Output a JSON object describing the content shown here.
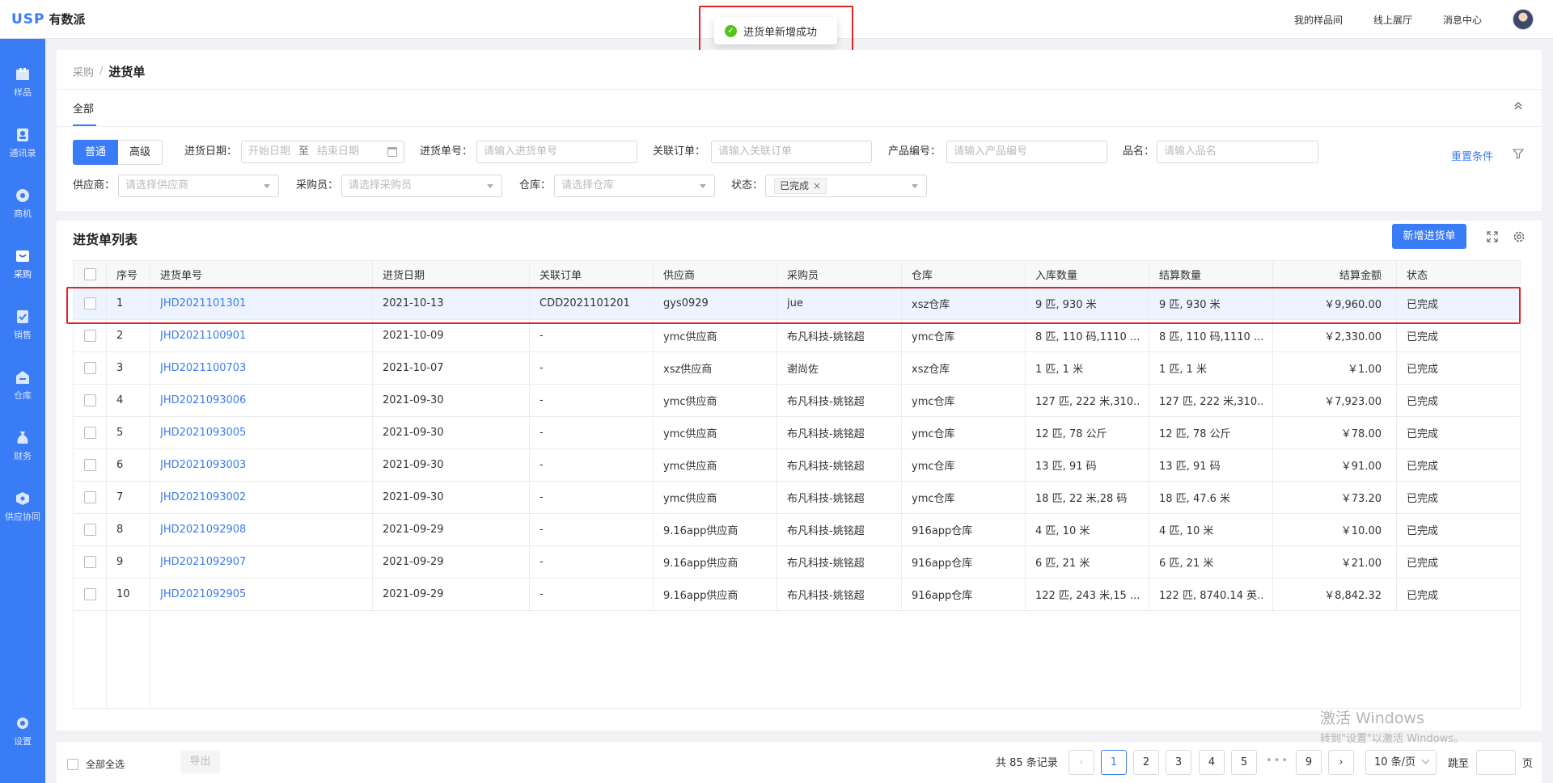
{
  "app": {
    "logo_mark": "USP",
    "logo_name": "有数派"
  },
  "topnav": {
    "items": [
      "我的样品间",
      "线上展厅",
      "消息中心"
    ]
  },
  "toast": {
    "message": "进货单新增成功"
  },
  "sidebar": {
    "items": [
      {
        "label": "样品",
        "icon": "sample-icon"
      },
      {
        "label": "通讯录",
        "icon": "contacts-icon"
      },
      {
        "label": "商机",
        "icon": "opportunity-icon"
      },
      {
        "label": "采购",
        "icon": "purchase-icon",
        "active": true
      },
      {
        "label": "销售",
        "icon": "sales-icon"
      },
      {
        "label": "仓库",
        "icon": "warehouse-icon"
      },
      {
        "label": "财务",
        "icon": "finance-icon"
      },
      {
        "label": "供应协同",
        "icon": "supply-icon"
      }
    ],
    "settings": "设置"
  },
  "breadcrumb": {
    "parent": "采购",
    "sep": "/",
    "current": "进货单"
  },
  "tabs": {
    "all": "全部"
  },
  "search": {
    "mode_normal": "普通",
    "mode_advanced": "高级",
    "date_label": "进货日期：",
    "date_start": "开始日期",
    "date_sep": "至",
    "date_end": "结束日期",
    "order_no_label": "进货单号：",
    "order_no_placeholder": "请输入进货单号",
    "related_label": "关联订单：",
    "related_placeholder": "请输入关联订单",
    "product_no_label": "产品编号：",
    "product_no_placeholder": "请输入产品编号",
    "product_name_label": "品名：",
    "product_name_placeholder": "请输入品名",
    "supplier_label": "供应商：",
    "supplier_placeholder": "请选择供应商",
    "buyer_label": "采购员：",
    "buyer_placeholder": "请选择采购员",
    "warehouse_label": "仓库：",
    "warehouse_placeholder": "请选择仓库",
    "status_label": "状态：",
    "status_tag": "已完成",
    "status_tag_close": "×",
    "reset": "重置条件"
  },
  "list": {
    "title": "进货单列表",
    "add_button": "新增进货单"
  },
  "table": {
    "headers": [
      "序号",
      "进货单号",
      "进货日期",
      "关联订单",
      "供应商",
      "采购员",
      "仓库",
      "入库数量",
      "结算数量",
      "结算金额",
      "状态"
    ],
    "rows": [
      [
        "1",
        "JHD2021101301",
        "2021-10-13",
        "CDD2021101201",
        "gys0929",
        "jue",
        "xsz仓库",
        "9 匹, 930 米",
        "9 匹, 930 米",
        "￥9,960.00",
        "已完成"
      ],
      [
        "2",
        "JHD2021100901",
        "2021-10-09",
        "-",
        "ymc供应商",
        "布凡科技-姚铭超",
        "ymc仓库",
        "8 匹, 110 码,1110 ...",
        "8 匹, 110 码,1110 ...",
        "￥2,330.00",
        "已完成"
      ],
      [
        "3",
        "JHD2021100703",
        "2021-10-07",
        "-",
        "xsz供应商",
        "谢尚佐",
        "xsz仓库",
        "1 匹, 1 米",
        "1 匹, 1 米",
        "￥1.00",
        "已完成"
      ],
      [
        "4",
        "JHD2021093006",
        "2021-09-30",
        "-",
        "ymc供应商",
        "布凡科技-姚铭超",
        "ymc仓库",
        "127 匹, 222 米,310...",
        "127 匹, 222 米,310...",
        "￥7,923.00",
        "已完成"
      ],
      [
        "5",
        "JHD2021093005",
        "2021-09-30",
        "-",
        "ymc供应商",
        "布凡科技-姚铭超",
        "ymc仓库",
        "12 匹, 78 公斤",
        "12 匹, 78 公斤",
        "￥78.00",
        "已完成"
      ],
      [
        "6",
        "JHD2021093003",
        "2021-09-30",
        "-",
        "ymc供应商",
        "布凡科技-姚铭超",
        "ymc仓库",
        "13 匹, 91 码",
        "13 匹, 91 码",
        "￥91.00",
        "已完成"
      ],
      [
        "7",
        "JHD2021093002",
        "2021-09-30",
        "-",
        "ymc供应商",
        "布凡科技-姚铭超",
        "ymc仓库",
        "18 匹, 22 米,28 码",
        "18 匹, 47.6 米",
        "￥73.20",
        "已完成"
      ],
      [
        "8",
        "JHD2021092908",
        "2021-09-29",
        "-",
        "9.16app供应商",
        "布凡科技-姚铭超",
        "916app仓库",
        "4 匹, 10 米",
        "4 匹, 10 米",
        "￥10.00",
        "已完成"
      ],
      [
        "9",
        "JHD2021092907",
        "2021-09-29",
        "-",
        "9.16app供应商",
        "布凡科技-姚铭超",
        "916app仓库",
        "6 匹, 21 米",
        "6 匹, 21 米",
        "￥21.00",
        "已完成"
      ],
      [
        "10",
        "JHD2021092905",
        "2021-09-29",
        "-",
        "9.16app供应商",
        "布凡科技-姚铭超",
        "916app仓库",
        "122 匹, 243 米,15 ...",
        "122 匹, 8740.14 英...",
        "￥8,842.32",
        "已完成"
      ]
    ]
  },
  "footer": {
    "select_all": "全部全选",
    "export": "导出",
    "total": "共 85 条记录",
    "pages": [
      "1",
      "2",
      "3",
      "4",
      "5",
      "9"
    ],
    "ellipsis": "•••",
    "page_size": "10 条/页",
    "jump": "跳至",
    "page_unit": "页"
  },
  "watermark": {
    "line1": "激活 Windows",
    "line2": "转到\"设置\"以激活 Windows。"
  },
  "colors": {
    "primary": "#3a7bf6",
    "success": "#52c41a",
    "highlight": "#e02424"
  }
}
